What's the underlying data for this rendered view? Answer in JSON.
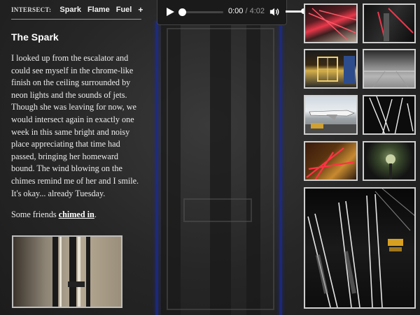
{
  "nav": {
    "title": "INTERSECT:",
    "links": [
      "Spark",
      "Flame",
      "Fuel",
      "+"
    ]
  },
  "post": {
    "title": "The Spark",
    "body": "I looked up from the escalator and could see myself in the chrome-like finish on the ceiling surrounded by neon lights and the sounds of jets. Though she was leaving for now, we would intersect again in exactly one week in this same bright and noisy place appreciating that time had passed, bringing her homeward bound. The wind blowing on the chimes remind me of her and I smile. It's okay... already Tuesday.",
    "friends_prefix": "Some friends ",
    "friends_link": "chimed in",
    "friends_suffix": "."
  },
  "player": {
    "current_time": "0:00",
    "separator": " / ",
    "duration": "4:02",
    "progress": 0
  },
  "thumbnails": [
    {
      "name": "thumb-neon-ceiling"
    },
    {
      "name": "thumb-dark-corner"
    },
    {
      "name": "thumb-lit-window"
    },
    {
      "name": "thumb-floor-gray"
    },
    {
      "name": "thumb-airplane-gate"
    },
    {
      "name": "thumb-light-streaks"
    },
    {
      "name": "thumb-red-neon"
    },
    {
      "name": "thumb-green-light"
    },
    {
      "name": "thumb-escalators-large"
    }
  ],
  "colors": {
    "background": "#2b2b2b",
    "border": "#cfcfcf",
    "neon_red": "#e8384a",
    "neon_blue": "#1b2a8c"
  }
}
